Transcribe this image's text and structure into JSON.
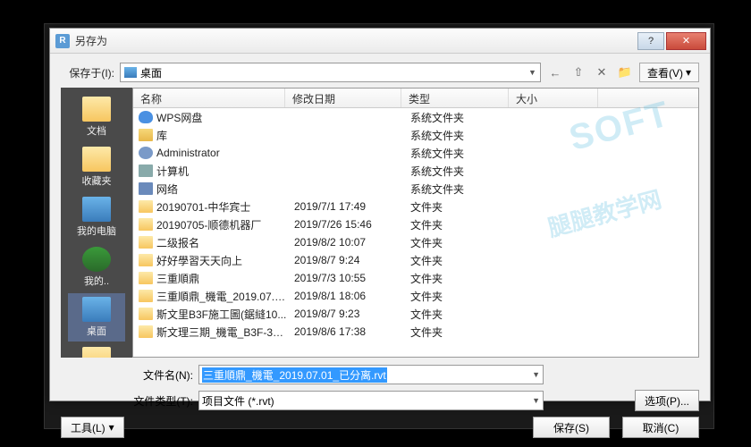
{
  "dialog": {
    "title": "另存为",
    "app_icon": "R"
  },
  "save_in": {
    "label": "保存于(I):",
    "location_icon": "desktop-icon",
    "location": "桌面"
  },
  "nav": {
    "back": "←",
    "up": "⇧",
    "delete": "✕",
    "new_folder": "📁"
  },
  "view_button": "查看(V)",
  "sidebar": [
    {
      "icon": "folder",
      "label": "文档"
    },
    {
      "icon": "folder",
      "label": "收藏夹"
    },
    {
      "icon": "monitor",
      "label": "我的电脑"
    },
    {
      "icon": "globe",
      "label": "我的.."
    },
    {
      "icon": "monitor",
      "label": "桌面",
      "selected": true
    },
    {
      "icon": "folder",
      "label": ""
    }
  ],
  "columns": {
    "name": "名称",
    "date": "修改日期",
    "type": "类型",
    "size": "大小"
  },
  "files": [
    {
      "icon": "cloud",
      "name": "WPS网盘",
      "date": "",
      "type": "系统文件夹"
    },
    {
      "icon": "lib",
      "name": "库",
      "date": "",
      "type": "系统文件夹"
    },
    {
      "icon": "user",
      "name": "Administrator",
      "date": "",
      "type": "系统文件夹"
    },
    {
      "icon": "comp",
      "name": "计算机",
      "date": "",
      "type": "系统文件夹"
    },
    {
      "icon": "net",
      "name": "网络",
      "date": "",
      "type": "系统文件夹"
    },
    {
      "icon": "fold",
      "name": "20190701-中华宾士",
      "date": "2019/7/1 17:49",
      "type": "文件夹"
    },
    {
      "icon": "fold",
      "name": "20190705-顺德机器厂",
      "date": "2019/7/26 15:46",
      "type": "文件夹"
    },
    {
      "icon": "fold",
      "name": "二级报名",
      "date": "2019/8/2 10:07",
      "type": "文件夹"
    },
    {
      "icon": "fold",
      "name": "好好學習天天向上",
      "date": "2019/8/7 9:24",
      "type": "文件夹"
    },
    {
      "icon": "fold",
      "name": "三重順鼎",
      "date": "2019/7/3 10:55",
      "type": "文件夹"
    },
    {
      "icon": "fold",
      "name": "三重順鼎_機電_2019.07.0...",
      "date": "2019/8/1 18:06",
      "type": "文件夹"
    },
    {
      "icon": "fold",
      "name": "斯文里B3F施工圖(鋸縫10...",
      "date": "2019/8/7 9:23",
      "type": "文件夹"
    },
    {
      "icon": "fold",
      "name": "斯文理三期_機電_B3F-3F...",
      "date": "2019/8/6 17:38",
      "type": "文件夹"
    }
  ],
  "filename": {
    "label": "文件名(N):",
    "value": "三重順鼎_機電_2019.07.01_已分离.rvt"
  },
  "filetype": {
    "label": "文件类型(T):",
    "value": "项目文件 (*.rvt)"
  },
  "buttons": {
    "options": "选项(P)...",
    "tools": "工具(L)",
    "save": "保存(S)",
    "cancel": "取消(C)"
  },
  "watermark": {
    "line1": "SOFT",
    "line2": "腿腿教学网"
  }
}
